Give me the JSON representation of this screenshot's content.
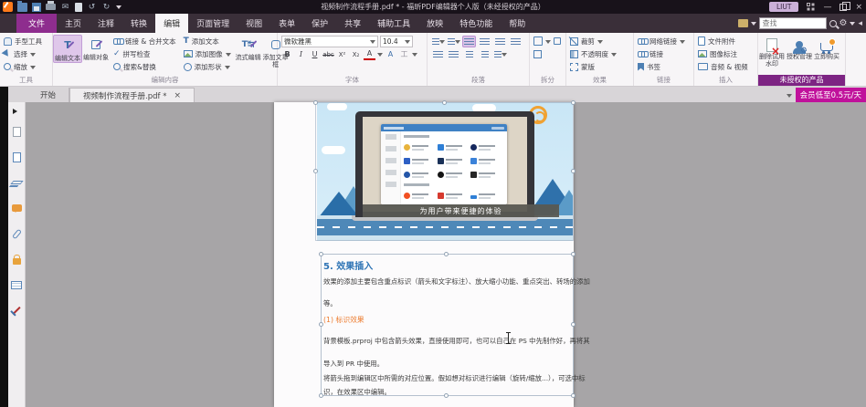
{
  "titlebar": {
    "title": "视频制作流程手册.pdf * - 福昕PDF编辑器个人版（未经授权的产品）",
    "user_badge": "LIUT",
    "minimize_glyph": "—",
    "close_glyph": "×"
  },
  "find": {
    "placeholder": "查找",
    "gear_glyph": "⚙",
    "collapse_glyph": "◂"
  },
  "quick_access": {
    "undo_glyph": "↺",
    "redo_glyph": "↻",
    "mail_glyph": "✉"
  },
  "menu_tabs": [
    "文件",
    "主页",
    "注释",
    "转换",
    "编辑",
    "页面管理",
    "视图",
    "表单",
    "保护",
    "共享",
    "辅助工具",
    "放映",
    "特色功能",
    "帮助"
  ],
  "ribbon": {
    "tools": {
      "label": "工具",
      "hand": "手型工具",
      "select": "选择",
      "zoom": "缩放"
    },
    "edit_content": {
      "label": "编辑内容",
      "edit_text": "编辑文本",
      "edit_object": "编辑对象",
      "link_join": "链接 & 合并文本",
      "spell_check": "拼写检查",
      "search_replace": "搜索&替换",
      "add_text": "添加文本",
      "add_image": "添加图像",
      "add_shape": "添加形状",
      "flow_edit": "流式编辑",
      "add_article_box": "添加文章框"
    },
    "font": {
      "label": "字体",
      "family": "微软雅黑",
      "size": "10.4",
      "bold": "B",
      "italic": "I",
      "underline": "U",
      "strike": "abc",
      "superscript": "X²",
      "subscript": "X₂",
      "color": "A",
      "spacing": "A",
      "vertical": "工"
    },
    "paragraph": {
      "label": "段落"
    },
    "split": {
      "label": "拆分"
    },
    "effect": {
      "label": "效果",
      "crop": "裁剪",
      "opacity": "不透明度",
      "mask": "蒙版"
    },
    "link": {
      "label": "链接",
      "web_link": "网络链接",
      "link": "链接",
      "bookmark": "书签"
    },
    "insert": {
      "label": "插入",
      "file_attach": "文件附件",
      "image_note": "图像标注",
      "audio_video": "音频 & 视频"
    },
    "unauthorized": {
      "label": "未授权的产品",
      "remove_watermark": "删除试用水印",
      "license_manage": "授权管理",
      "buy_now": "立即购买"
    }
  },
  "doc_tabs": {
    "start": "开始",
    "document": "视频制作流程手册.pdf *",
    "close_glyph": "×"
  },
  "promo_banner": "会员低至0.5元/天",
  "page": {
    "illustration_caption": "为用户带来便捷的体验",
    "heading": "5. 效果插入",
    "para1_line1": "效果的添加主要包含重点标识（箭头和文字标注）、放大缩小功能、重点突出、转场的添加",
    "para1_line2": "等。",
    "subheading": "(1) 标识效果",
    "para2_line1": "背景模板.prproj 中包含箭头效果，直接使用即可，也可以自己在 PS 中先制作好，再将其",
    "para2_line2": "导入到 PR 中使用。",
    "para3_line1": "将箭头拖到编辑区中所需的对应位置。假如想对标识进行编辑（旋转/缩放...），可选中标",
    "para3_line2": "识，在效果区中编辑。"
  },
  "colors": {
    "accent_purple": "#8e2d8e",
    "banner_magenta": "#c0119b",
    "heading_blue": "#2e74b5",
    "subheading_orange": "#ed7d31"
  }
}
